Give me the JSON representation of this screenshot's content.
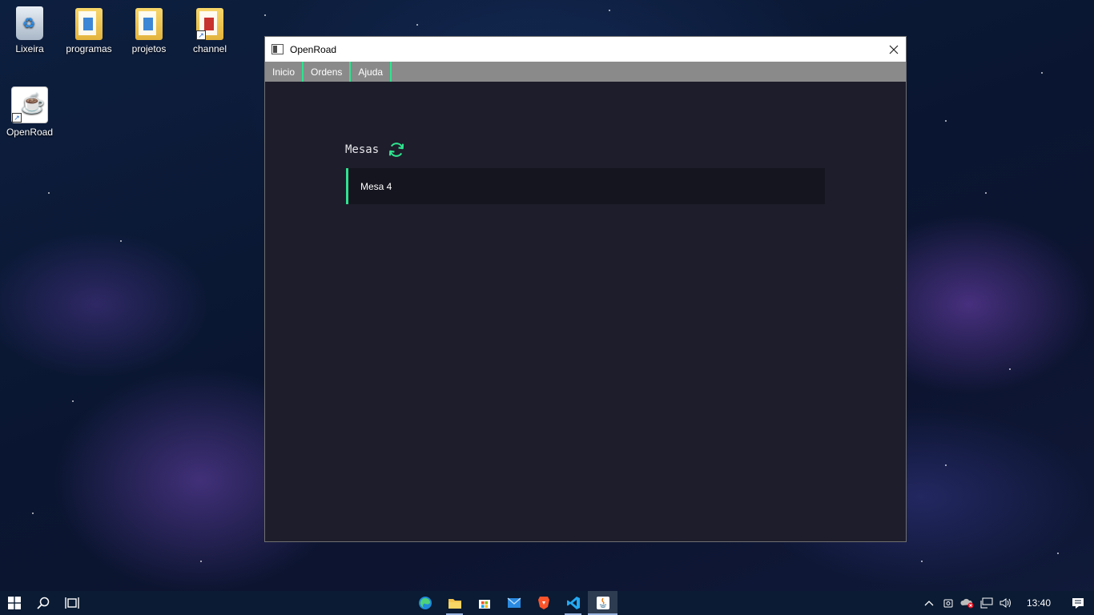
{
  "desktop": {
    "icons": [
      {
        "label": "Lixeira",
        "icon": "recycle-bin-icon"
      },
      {
        "label": "programas",
        "icon": "folder-icon"
      },
      {
        "label": "projetos",
        "icon": "folder-icon"
      },
      {
        "label": "channel",
        "icon": "folder-shortcut-icon"
      },
      {
        "label": "OpenRoad",
        "icon": "java-shortcut-icon"
      }
    ]
  },
  "window": {
    "title": "OpenRoad",
    "menu": [
      "Inicio",
      "Ordens",
      "Ajuda"
    ],
    "accent_color": "#2fe38f",
    "section_title": "Mesas",
    "tables": [
      {
        "label": "Mesa 4"
      }
    ]
  },
  "taskbar": {
    "pinned_apps": [
      "edge-icon",
      "file-explorer-icon",
      "microsoft-store-icon",
      "mail-icon",
      "brave-icon",
      "vscode-icon",
      "java-app-icon"
    ],
    "clock": "13:40"
  }
}
